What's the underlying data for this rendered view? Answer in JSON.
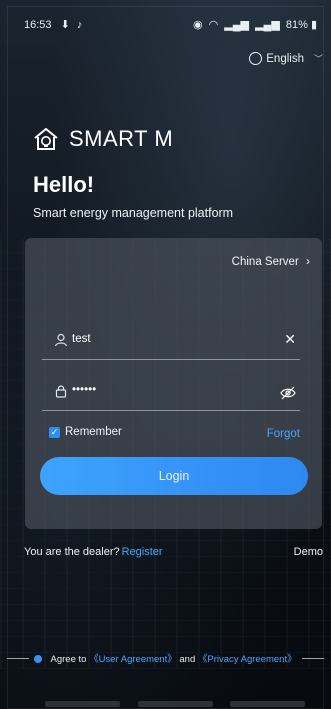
{
  "status_bar": {
    "time": "16:53",
    "right_text": "81%",
    "icons": [
      "download-icon",
      "notification-icon",
      "alarm-icon",
      "wifi-icon",
      "signal-icon",
      "signal-icon",
      "battery-icon"
    ]
  },
  "language": {
    "label": "English",
    "icon": "globe-icon"
  },
  "brand": {
    "name": "SMART M"
  },
  "greeting": "Hello!",
  "subtitle": "Smart energy management platform",
  "login_card": {
    "server_label": "China Server",
    "username": {
      "value": "test",
      "clear_icon": "close-icon"
    },
    "password": {
      "value": "••••••",
      "toggle_icon": "eye-off-icon"
    },
    "remember": {
      "label": "Remember",
      "checked": true
    },
    "forgot_label": "Forgot",
    "login_label": "Login"
  },
  "dealer": {
    "text": "You are the dealer?",
    "register_label": "Register"
  },
  "demo_label": "Demo",
  "agreement": {
    "prefix": "Agree to",
    "user_agreement": "《User Agreement》",
    "and": "and",
    "privacy_agreement": "《Privacy Agreement》"
  },
  "colors": {
    "accent": "#2f8ff0",
    "link": "#47a6ff"
  }
}
